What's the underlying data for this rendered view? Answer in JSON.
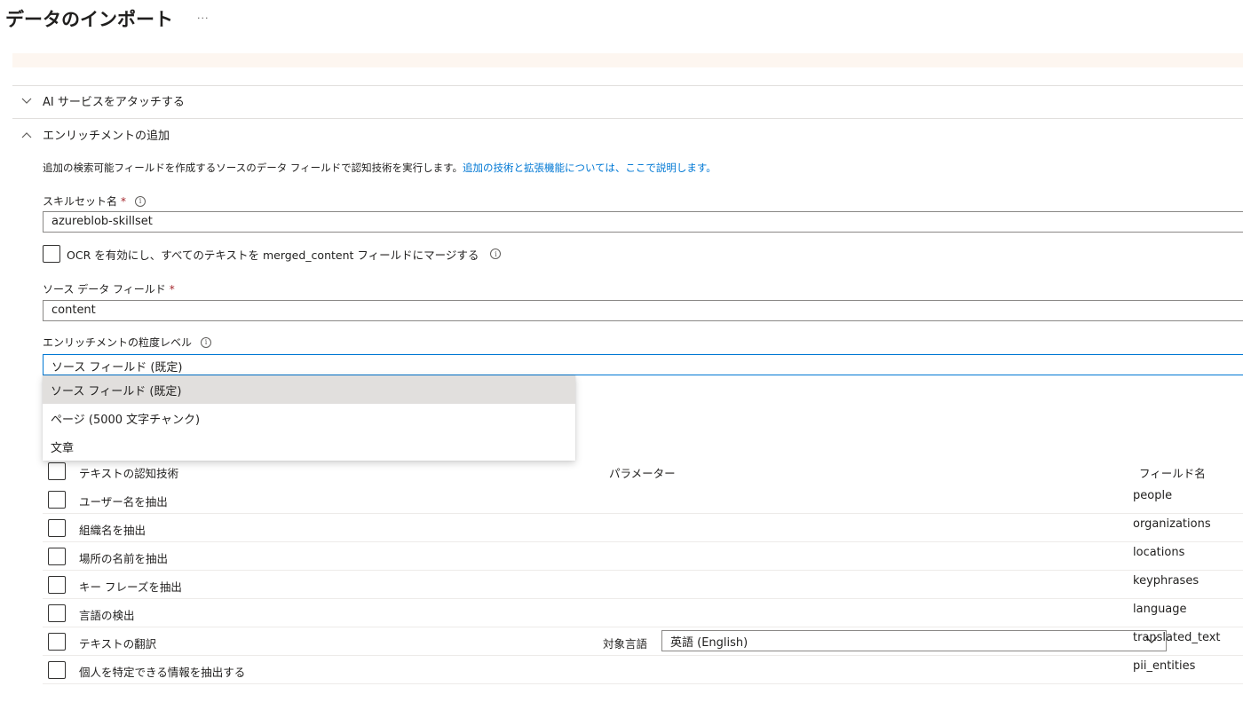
{
  "page": {
    "title": "データのインポート",
    "more": "···"
  },
  "sections": {
    "ai_services": {
      "label": "AI サービスをアタッチする"
    },
    "enrichment": {
      "label": "エンリッチメントの追加"
    }
  },
  "description": {
    "text": "追加の検索可能フィールドを作成するソースのデータ フィールドで認知技術を実行します。",
    "link": "追加の技術と拡張機能については、ここで説明します。"
  },
  "skillset": {
    "label": "スキルセット名",
    "required_mark": "*",
    "value": "azureblob-skillset"
  },
  "ocr": {
    "label": "OCR を有効にし、すべてのテキストを merged_content フィールドにマージする"
  },
  "source_field": {
    "label": "ソース データ フィールド",
    "required_mark": "*",
    "value": "content"
  },
  "granularity": {
    "label": "エンリッチメントの粒度レベル",
    "value": "ソース フィールド (既定)",
    "options": [
      "ソース フィールド (既定)",
      "ページ (5000 文字チャンク)",
      "文章"
    ]
  },
  "skills_table": {
    "headers": {
      "skill": "テキストの認知技術",
      "params": "パラメーター",
      "field": "フィールド名"
    },
    "rows": [
      {
        "label": "ユーザー名を抽出",
        "field": "people"
      },
      {
        "label": "組織名を抽出",
        "field": "organizations"
      },
      {
        "label": "場所の名前を抽出",
        "field": "locations"
      },
      {
        "label": "キー フレーズを抽出",
        "field": "keyphrases"
      },
      {
        "label": "言語の検出",
        "field": "language"
      },
      {
        "label": "テキストの翻訳",
        "field": "translated_text",
        "param_label": "対象言語",
        "param_value": "英語 (English)"
      },
      {
        "label": "個人を特定できる情報を抽出する",
        "field": "pii_entities"
      }
    ]
  },
  "icons": {
    "info": "info-icon",
    "chevron_down": "chevron-down-icon",
    "chevron_up": "chevron-up-icon",
    "checkbox": "checkbox"
  },
  "colors": {
    "link": "#0078d4",
    "required": "#a4262c",
    "warning_bg": "#fdf6f0",
    "focus_border": "#0078d4"
  }
}
